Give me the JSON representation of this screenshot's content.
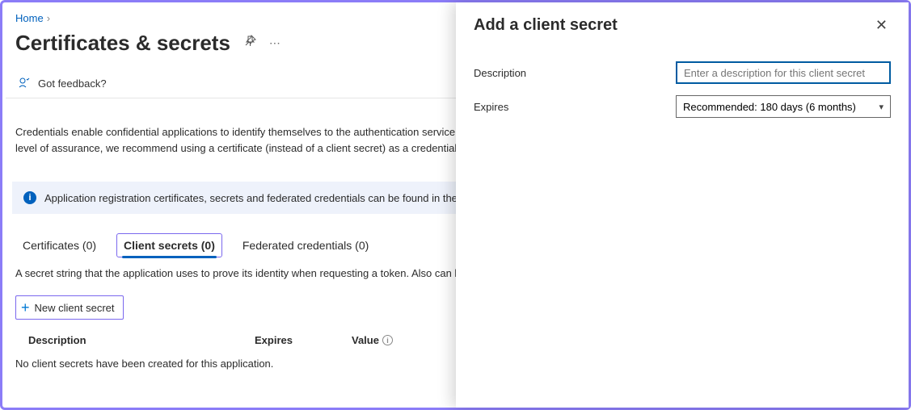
{
  "breadcrumb": {
    "home": "Home"
  },
  "page": {
    "title": "Certificates & secrets",
    "feedback": "Got feedback?",
    "intro": "Credentials enable confidential applications to identify themselves to the authentication service when receiving tokens at a web addressable location (using an HTTPS scheme). For a higher level of assurance, we recommend using a certificate (instead of a client secret) as a credential.",
    "info_banner": "Application registration certificates, secrets and federated credentials can be found in the tabs below."
  },
  "tabs": {
    "certificates": "Certificates (0)",
    "client_secrets": "Client secrets (0)",
    "federated": "Federated credentials (0)"
  },
  "tab_desc": "A secret string that the application uses to prove its identity when requesting a token. Also can be referred to as application password.",
  "new_secret_btn": "New client secret",
  "table": {
    "col_description": "Description",
    "col_expires": "Expires",
    "col_value": "Value",
    "empty": "No client secrets have been created for this application."
  },
  "panel": {
    "title": "Add a client secret",
    "desc_label": "Description",
    "desc_placeholder": "Enter a description for this client secret",
    "expires_label": "Expires",
    "expires_value": "Recommended: 180 days (6 months)"
  }
}
